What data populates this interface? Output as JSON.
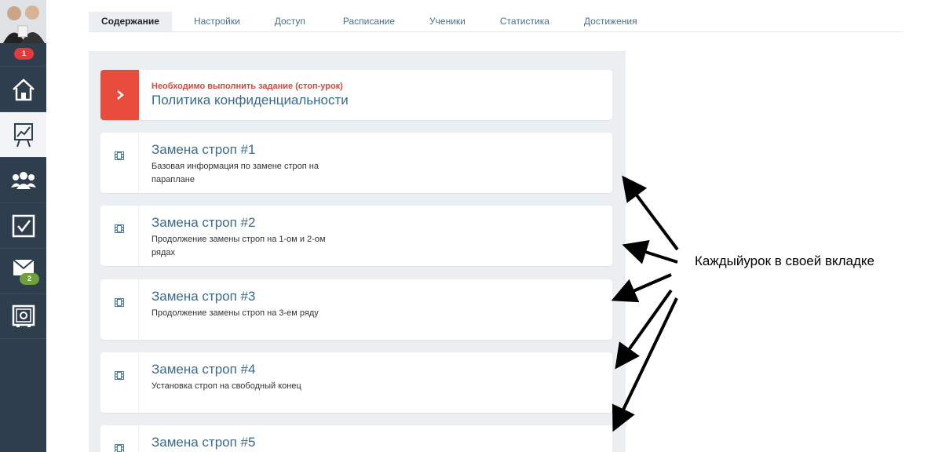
{
  "sidebar": {
    "notifications_badge": "1",
    "mail_badge": "2",
    "items": [
      {
        "name": "home",
        "icon": "home-icon",
        "active": false
      },
      {
        "name": "stats",
        "icon": "chart-board-icon",
        "active": true
      },
      {
        "name": "users",
        "icon": "users-icon",
        "active": false
      },
      {
        "name": "tasks",
        "icon": "checkbox-icon",
        "active": false
      },
      {
        "name": "mail",
        "icon": "mail-icon",
        "active": false
      },
      {
        "name": "safe",
        "icon": "safe-icon",
        "active": false
      }
    ]
  },
  "tabs": [
    {
      "label": "Содержание",
      "active": true
    },
    {
      "label": "Настройки",
      "active": false
    },
    {
      "label": "Доступ",
      "active": false
    },
    {
      "label": "Расписание",
      "active": false
    },
    {
      "label": "Ученики",
      "active": false
    },
    {
      "label": "Статистика",
      "active": false
    },
    {
      "label": "Достижения",
      "active": false
    }
  ],
  "stop_lesson": {
    "notice": "Необходимо выполнить задание (стоп-урок)",
    "title": "Политика конфиденциальности",
    "icon": "chevron-right-icon"
  },
  "lessons": [
    {
      "title": "Замена строп #1",
      "description": "Базовая информация по замене строп на параплане",
      "icon": "film-icon"
    },
    {
      "title": "Замена строп #2",
      "description": "Продолжение замены строп на 1-ом и 2-ом рядах",
      "icon": "film-icon"
    },
    {
      "title": "Замена строп #3",
      "description": "Продолжение замены строп на 3-ем ряду",
      "icon": "film-icon"
    },
    {
      "title": "Замена строп #4",
      "description": "Установка строп на свободный конец",
      "icon": "film-icon"
    },
    {
      "title": "Замена строп #5",
      "description": "",
      "icon": "film-icon"
    }
  ],
  "annotation": {
    "text": "Каждыйурок в своей вкладке"
  },
  "colors": {
    "sidebar_bg": "#2f3e4d",
    "accent_red": "#e74c3c",
    "link_blue": "#3c6a8a",
    "badge_green": "#6ea13b"
  }
}
